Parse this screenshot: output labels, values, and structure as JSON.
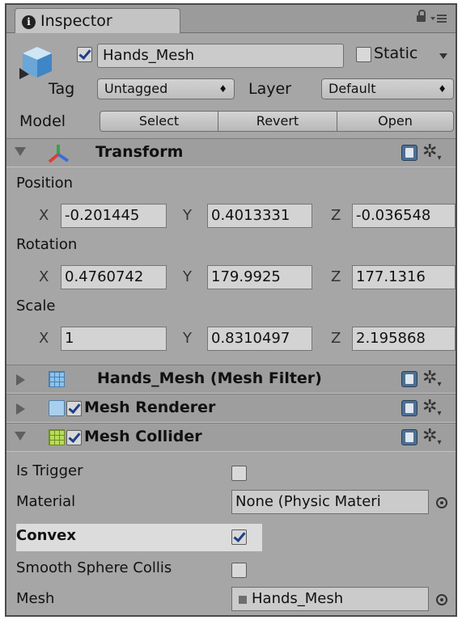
{
  "tab": {
    "title": "Inspector",
    "info_glyph": "i"
  },
  "object": {
    "name": "Hands_Mesh",
    "active": true,
    "static_label": "Static",
    "static_checked": false
  },
  "tag": {
    "label": "Tag",
    "value": "Untagged"
  },
  "layer": {
    "label": "Layer",
    "value": "Default"
  },
  "model": {
    "label": "Model",
    "buttons": [
      "Select",
      "Revert",
      "Open"
    ]
  },
  "transform": {
    "title": "Transform",
    "position": {
      "label": "Position",
      "x": "-0.201445",
      "y": "0.4013331",
      "z": "-0.036548"
    },
    "rotation": {
      "label": "Rotation",
      "x": "0.4760742",
      "y": "179.9925",
      "z": "177.1316"
    },
    "scale": {
      "label": "Scale",
      "x": "1",
      "y": "0.8310497",
      "z": "2.195868"
    },
    "axes": {
      "x": "X",
      "y": "Y",
      "z": "Z"
    }
  },
  "mesh_filter": {
    "title": "Hands_Mesh (Mesh Filter)"
  },
  "mesh_renderer": {
    "title": "Mesh Renderer",
    "enabled": true
  },
  "mesh_collider": {
    "title": "Mesh Collider",
    "enabled": true,
    "is_trigger": {
      "label": "Is Trigger",
      "checked": false
    },
    "material": {
      "label": "Material",
      "value": "None (Physic Materi"
    },
    "convex": {
      "label": "Convex",
      "checked": true
    },
    "smooth": {
      "label": "Smooth Sphere Collis",
      "checked": false
    },
    "mesh": {
      "label": "Mesh",
      "value": "Hands_Mesh"
    }
  },
  "gear_glyph": "✲"
}
